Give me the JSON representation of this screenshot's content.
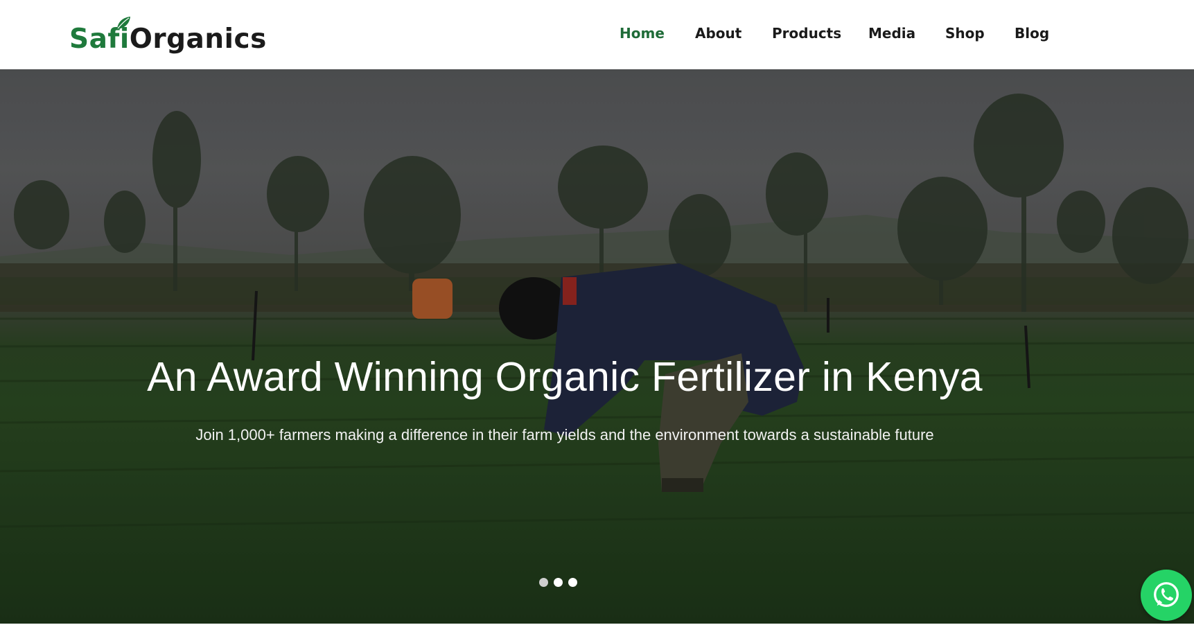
{
  "brand": {
    "safi": "Safi",
    "organics": "Organics"
  },
  "nav": {
    "items": [
      {
        "label": "Home",
        "active": true
      },
      {
        "label": "About"
      },
      {
        "label": "Products"
      },
      {
        "label": "Media"
      },
      {
        "label": "Shop"
      },
      {
        "label": "Blog"
      }
    ]
  },
  "hero": {
    "title": "An Award Winning Organic Fertilizer in Kenya",
    "subtitle": "Join 1,000+ farmers making a difference in their farm yields and the environment towards a sustainable future",
    "slides_total": 3,
    "active_slide": 2
  },
  "colors": {
    "brand_green": "#1f7a3c",
    "nav_active": "#1f6b38",
    "whatsapp": "#25d366"
  },
  "icons": {
    "logo_leaf": "leaf-icon",
    "chat": "whatsapp-icon"
  }
}
